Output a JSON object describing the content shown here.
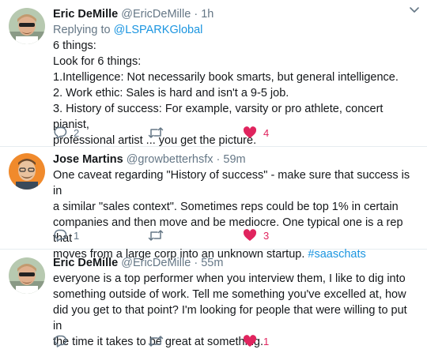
{
  "tweets": [
    {
      "name": "Eric DeMille",
      "handle": "@EricDeMille",
      "separator": "·",
      "time": "1h",
      "reply_prefix": "Replying to ",
      "reply_to": "@LSPARKGlobal",
      "lines": [
        "6 things:",
        "Look for 6 things:",
        "1.Intelligence: Not necessarily book smarts, but general intelligence.",
        "2. Work ethic: Sales is hard and isn't a 9-5 job.",
        "3. History of success: For example, varsity or pro athlete, concert pianist,",
        "professional artist ... you get the picture."
      ],
      "replies": "2",
      "likes": "4"
    },
    {
      "name": "Jose Martins",
      "handle": "@growbetterhsfx",
      "separator": "·",
      "time": "59m",
      "lines": [
        "One caveat regarding \"History of success\" - make sure that success is in",
        "a similar \"sales context\". Sometimes reps could be top 1% in certain",
        "companies and then move and be mediocre. One typical one is a rep that",
        "moves from a large corp into an unknown startup."
      ],
      "hashtag": "#saaschats",
      "replies": "1",
      "likes": "3"
    },
    {
      "name": "Eric DeMille",
      "handle": "@EricDeMille",
      "separator": "·",
      "time": "55m",
      "lines": [
        "everyone is a top performer when you interview them, I like to dig into",
        "something outside of work. Tell me something you've excelled at, how",
        "did you get to that point? I'm looking for people that were willing to put in",
        "the time it takes to be great at something."
      ],
      "replies": "",
      "likes": "1"
    }
  ],
  "colors": {
    "link": "#1b95e0",
    "like": "#e0245e",
    "muted": "#657786",
    "divider": "#e6ecf0"
  },
  "icons": {
    "reply": "reply-icon",
    "retweet": "retweet-icon",
    "like": "heart-icon",
    "more": "chevron-down-icon"
  }
}
